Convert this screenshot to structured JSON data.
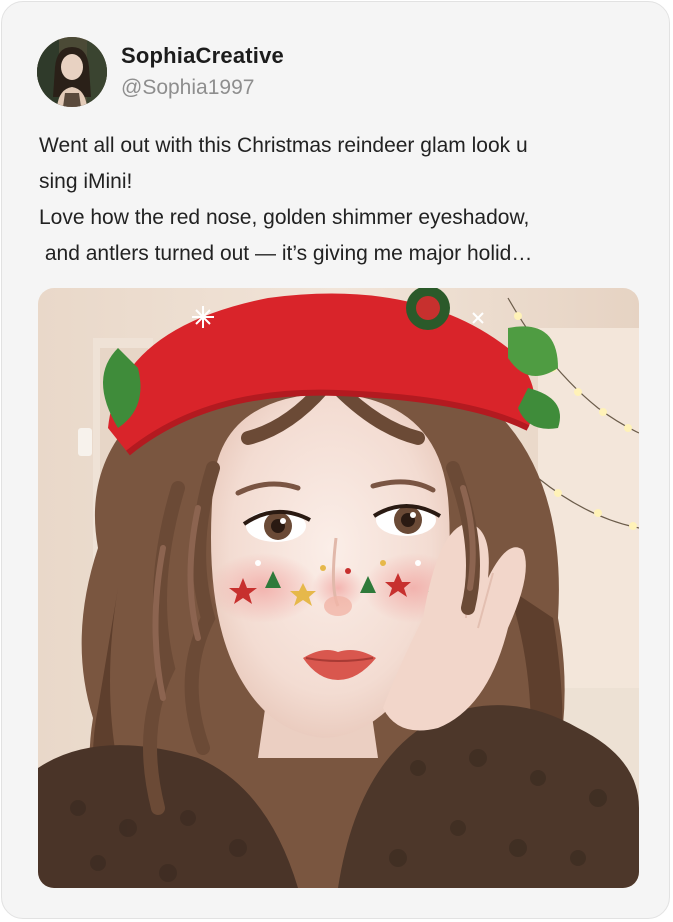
{
  "post": {
    "author": {
      "display_name": "SophiaCreative",
      "handle": "@Sophia1997"
    },
    "text": {
      "line1": "Went all out with this Christmas reindeer glam look u",
      "line2": "sing iMini!",
      "line3": "Love how the red nose, golden shimmer eyeshadow,",
      "line4": " and antlers turned out — it’s giving me major holid…"
    },
    "media": {
      "type": "photo",
      "subject": "selfie of girl with red beret, curly brown hair and festive face stickers"
    }
  },
  "colors": {
    "card_background": "#f5f5f5",
    "name_text": "#1c1c1c",
    "handle_text": "#8e8e8e",
    "body_text": "#222222"
  }
}
